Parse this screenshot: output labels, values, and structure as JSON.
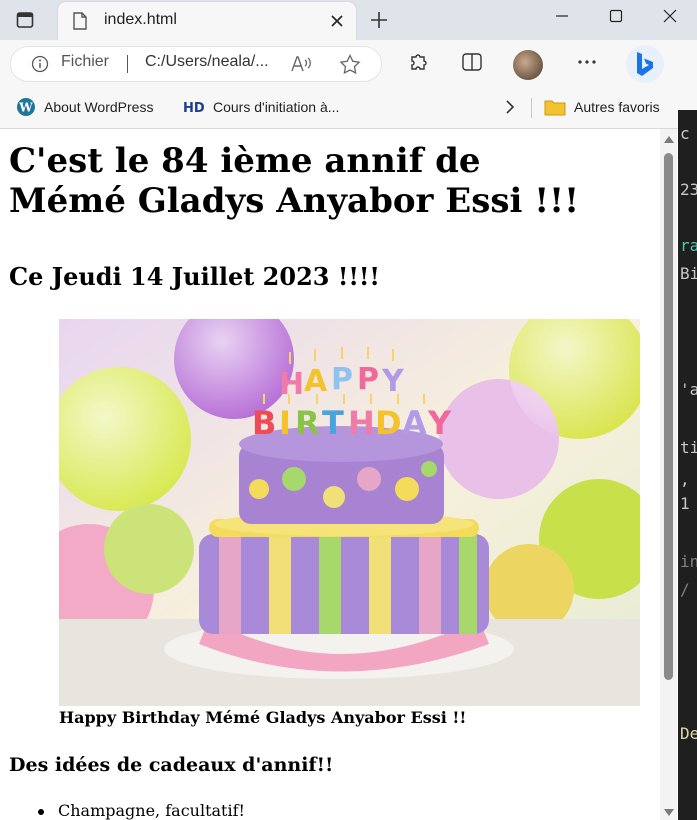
{
  "tab": {
    "title": "index.html"
  },
  "address": {
    "file_label": "Fichier",
    "url": "C:/Users/neala/..."
  },
  "favorites": {
    "items": [
      {
        "label": "About WordPress"
      },
      {
        "label": "Cours d'initiation à..."
      }
    ],
    "other": "Autres favoris"
  },
  "page": {
    "title": "C'est le 84 ième annif de Mémé Gladys Anyabor Essi !!!",
    "subtitle": "Ce Jeudi 14 Juillet 2023 !!!!",
    "image_caption": "Happy Birthday Mémé Gladys Anyabor Essi !!",
    "gifts_heading": "Des idées de cadeaux d'annif!!",
    "gifts": [
      "Champagne, facultatif!"
    ],
    "cake_topper": "HAPPY BIRTHDAY"
  },
  "background_editor": {
    "fragments": [
      "c",
      "23",
      "ra",
      "Bi",
      "'a",
      "ti",
      ",",
      "1",
      "in",
      "/",
      "De"
    ]
  },
  "icons": {
    "sidebar": "sidebar-toggle-icon",
    "favicon": "document-icon",
    "close": "close-icon",
    "new_tab": "plus-icon",
    "info": "info-icon",
    "read_aloud": "read-aloud-icon",
    "favorite": "star-icon",
    "extensions": "puzzle-icon",
    "split": "split-screen-icon",
    "more": "more-icon",
    "copilot": "bing-icon",
    "chevron": "chevron-right-icon",
    "folder": "folder-icon"
  },
  "colors": {
    "bing_blue": "#1a73e8",
    "folder_yellow": "#f2c230",
    "hd_blue": "#1c3e8f",
    "wp_blue": "#21759b"
  }
}
